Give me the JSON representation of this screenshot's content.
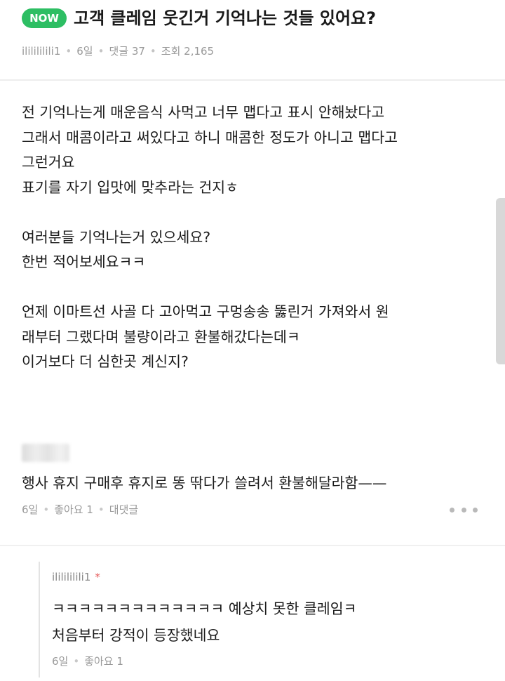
{
  "post": {
    "badge": "NOW",
    "title": "고객 클레임 웃긴거 기억나는 것들 있어요?",
    "author": "ililililili1",
    "time": "6일",
    "comments_label": "댓글 37",
    "views_label": "조회 2,165",
    "body_lines": [
      "전 기억나는게 매운음식 사먹고 너무 맵다고 표시 안해놨다고",
      "그래서 매콤이라고 써있다고 하니 매콤한 정도가 아니고 맵다고",
      "그런거요",
      "표기를 자기 입맛에 맞추라는 건지ㅎ",
      "",
      "여러분들 기억나는거 있으세요?",
      "한번 적어보세요ㅋㅋ",
      "",
      "언제 이마트선 사골 다 고아먹고 구멍송송 뚫린거 가져와서 원",
      "래부터 그랬다며 불량이라고 환불해갔다는데ㅋ",
      "이거보다 더 심한곳 계신지?"
    ]
  },
  "comment": {
    "text": "행사 휴지 구매후 휴지로 똥 딲다가 쓸려서 환불해달라함——",
    "time": "6일",
    "likes": "좋아요 1",
    "reply_label": "대댓글"
  },
  "reply": {
    "author": "ililililili1",
    "author_mark": "*",
    "lines": [
      "ㅋㅋㅋㅋㅋㅋㅋㅋㅋㅋㅋㅋㅋ 예상치 못한 클레임ㅋ",
      "처음부터 강적이 등장했네요"
    ],
    "time": "6일",
    "likes": "좋아요 1"
  },
  "colors": {
    "badge": "#2dbe63",
    "meta_text": "#999999",
    "author_mark": "#e65a5a"
  },
  "icons": {
    "more": "ellipsis-horizontal-icon"
  }
}
